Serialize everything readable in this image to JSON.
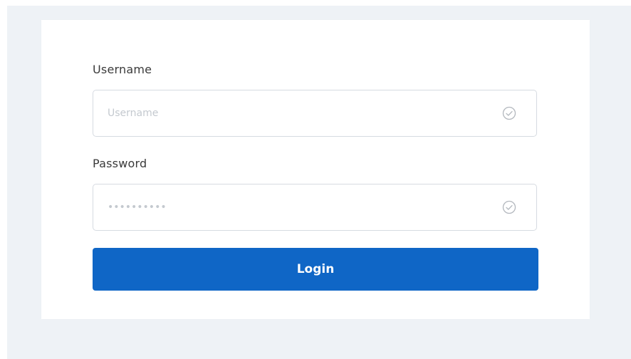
{
  "login_form": {
    "username": {
      "label": "Username",
      "placeholder": "Username",
      "value": "",
      "status_icon": "check-circle-icon"
    },
    "password": {
      "label": "Password",
      "placeholder": "••••••••••",
      "value": "",
      "status_icon": "check-circle-icon"
    },
    "submit_label": "Login"
  },
  "colors": {
    "primary_button": "#0f66c6",
    "page_background": "#eef2f6",
    "card_background": "#ffffff",
    "field_border": "#d6dbe1",
    "icon_stroke": "#b3b8be"
  }
}
